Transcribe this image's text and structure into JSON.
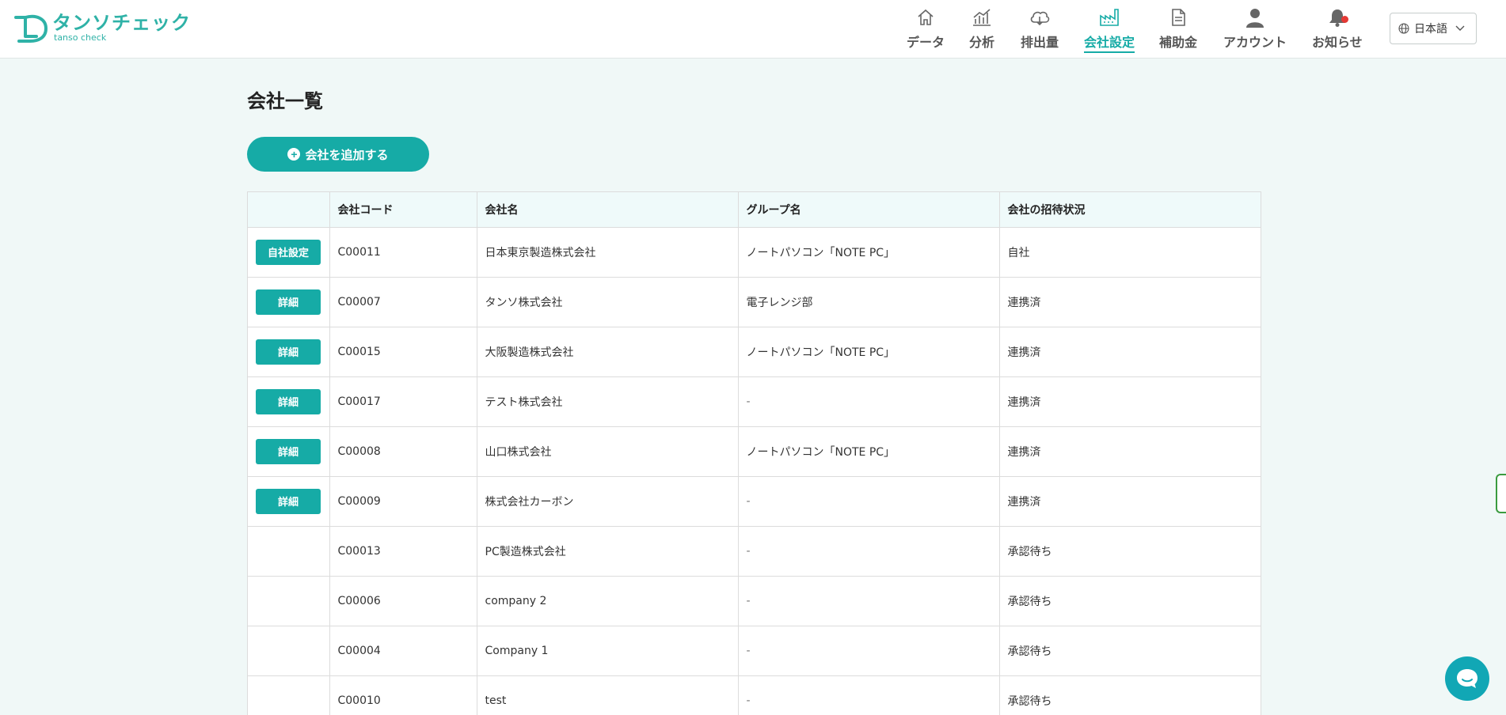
{
  "brand": {
    "name": "タンソチェック",
    "sub": "tanso check",
    "color": "#2fb2a7"
  },
  "nav": {
    "items": [
      {
        "label": "データ",
        "icon": "home-icon"
      },
      {
        "label": "分析",
        "icon": "analytics-icon"
      },
      {
        "label": "排出量",
        "icon": "cloud-icon"
      },
      {
        "label": "会社設定",
        "icon": "factory-icon",
        "active": true
      },
      {
        "label": "補助金",
        "icon": "document-icon"
      },
      {
        "label": "アカウント",
        "icon": "user-icon"
      },
      {
        "label": "お知らせ",
        "icon": "bell-icon"
      }
    ]
  },
  "lang": {
    "value": "日本語",
    "icon": "globe-icon"
  },
  "page": {
    "title": "会社一覧",
    "add_button": "会社を追加する"
  },
  "table": {
    "headers": [
      "",
      "会社コード",
      "会社名",
      "グループ名",
      "会社の招待状況"
    ],
    "rows": [
      {
        "action": "自社設定",
        "code": "C00011",
        "name": "日本東京製造株式会社",
        "group": "ノートパソコン「NOTE PC」",
        "status": "自社"
      },
      {
        "action": "詳細",
        "code": "C00007",
        "name": "タンソ株式会社",
        "group": "電子レンジ部",
        "status": "連携済"
      },
      {
        "action": "詳細",
        "code": "C00015",
        "name": "大阪製造株式会社",
        "group": "ノートパソコン「NOTE PC」",
        "status": "連携済"
      },
      {
        "action": "詳細",
        "code": "C00017",
        "name": "テスト株式会社",
        "group": "-",
        "status": "連携済"
      },
      {
        "action": "詳細",
        "code": "C00008",
        "name": "山口株式会社",
        "group": "ノートパソコン「NOTE PC」",
        "status": "連携済"
      },
      {
        "action": "詳細",
        "code": "C00009",
        "name": "株式会社カーボン",
        "group": "-",
        "status": "連携済"
      },
      {
        "action": "",
        "code": "C00013",
        "name": "PC製造株式会社",
        "group": "-",
        "status": "承認待ち"
      },
      {
        "action": "",
        "code": "C00006",
        "name": "company 2",
        "group": "-",
        "status": "承認待ち"
      },
      {
        "action": "",
        "code": "C00004",
        "name": "Company 1",
        "group": "-",
        "status": "承認待ち"
      },
      {
        "action": "",
        "code": "C00010",
        "name": "test",
        "group": "-",
        "status": "承認待ち"
      }
    ]
  },
  "colors": {
    "accent": "#16aba6",
    "background": "#f0f8f7",
    "header_row": "#effafa",
    "notification_dot": "#e53935"
  }
}
